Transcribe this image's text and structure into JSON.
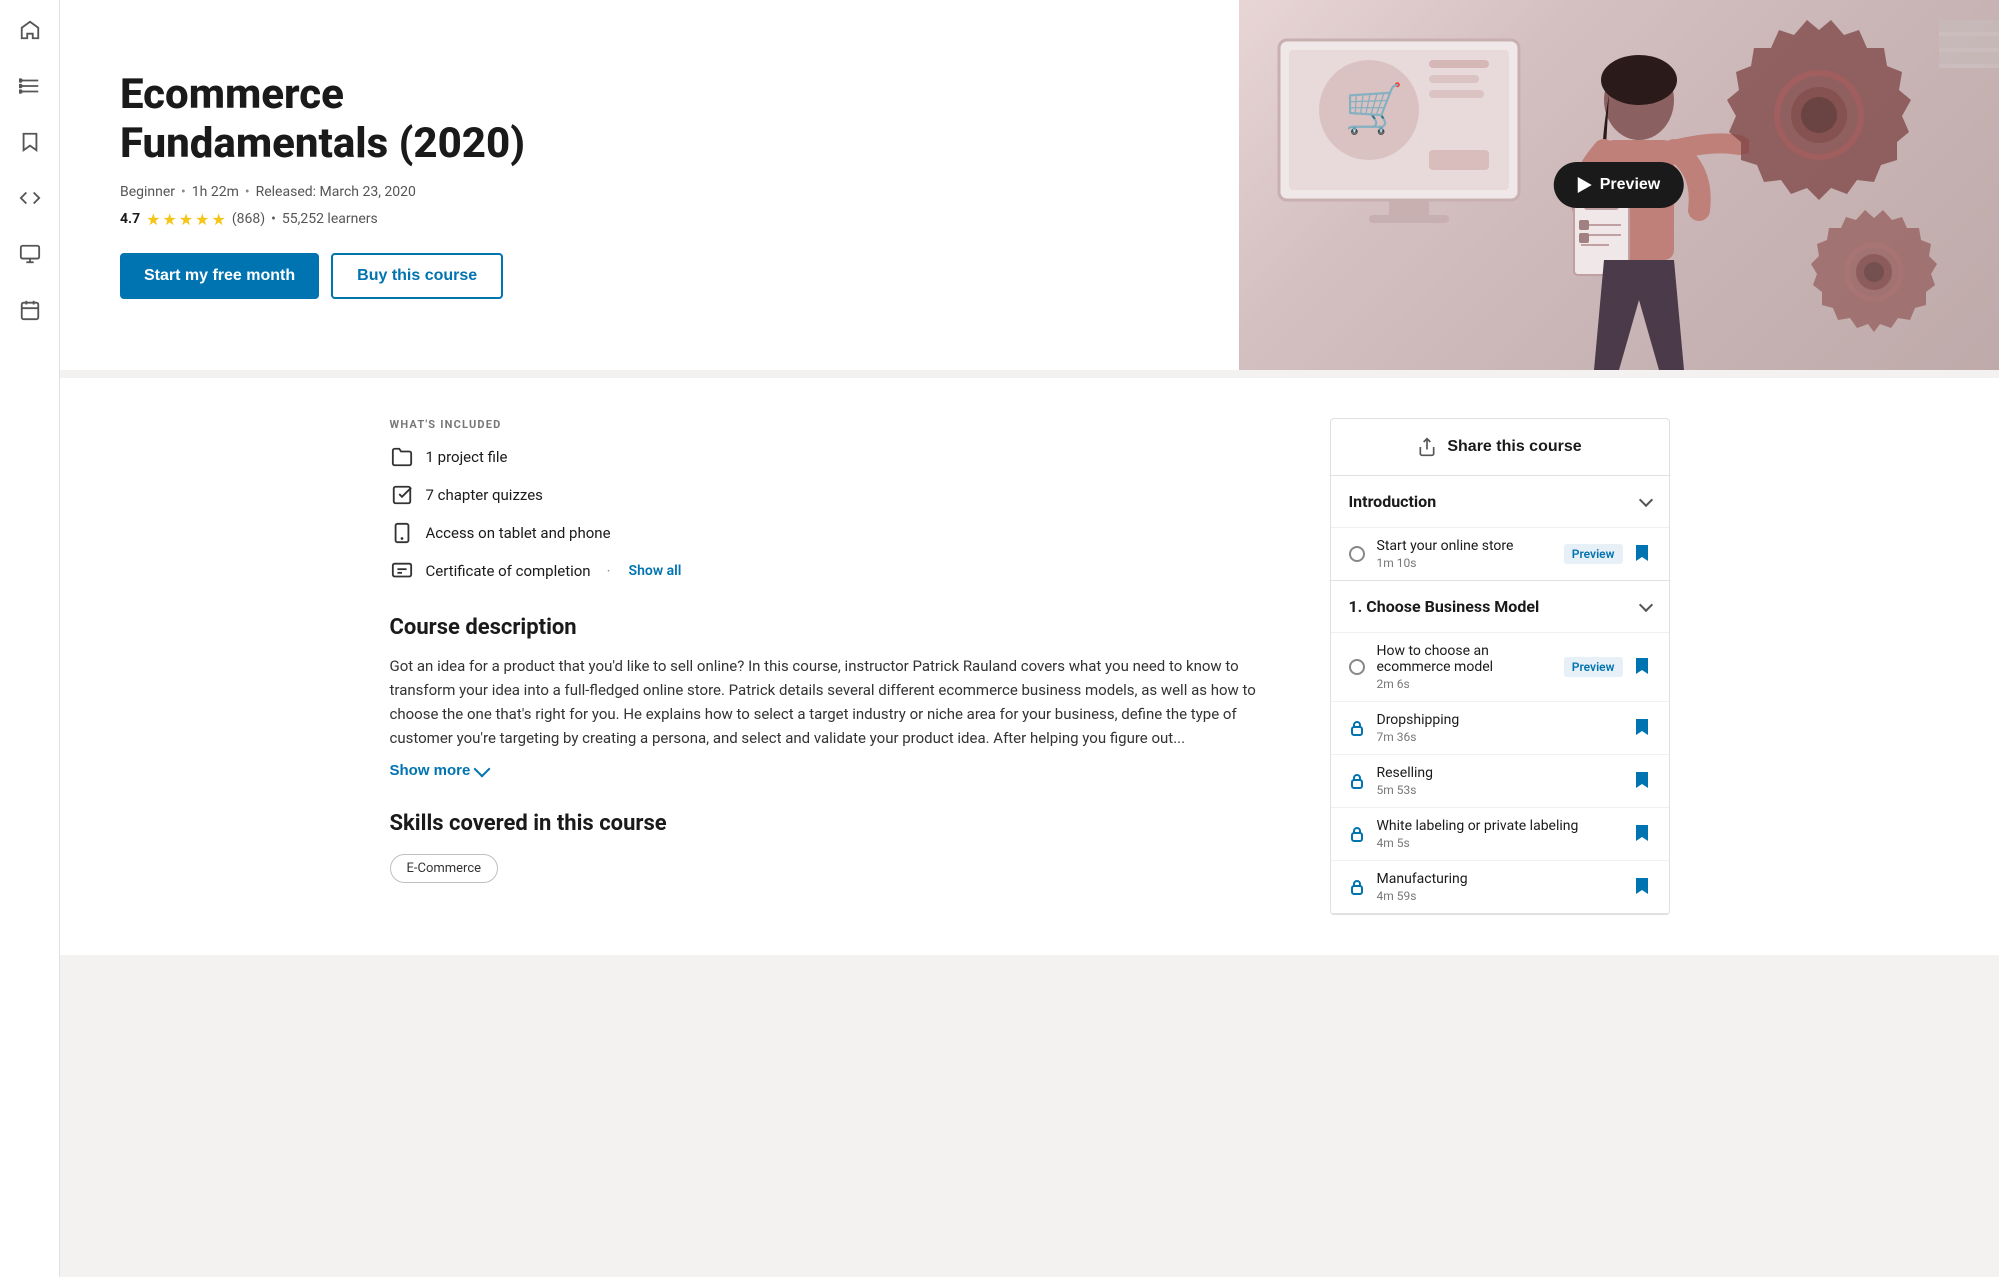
{
  "sidebar": {
    "icons": [
      "home",
      "list",
      "bookmark",
      "code",
      "monitor",
      "calendar"
    ]
  },
  "hero": {
    "title": "Ecommerce Fundamentals (2020)",
    "meta": {
      "level": "Beginner",
      "duration": "1h 22m",
      "released": "Released: March 23, 2020"
    },
    "rating": {
      "score": "4.7",
      "count": "(868)",
      "learners": "55,252 learners"
    },
    "buttons": {
      "primary": "Start my free month",
      "secondary": "Buy this course"
    },
    "preview_label": "Preview"
  },
  "whats_included": {
    "label": "WHAT'S INCLUDED",
    "items": [
      {
        "icon": "folder",
        "text": "1 project file"
      },
      {
        "icon": "quiz",
        "text": "7 chapter quizzes"
      },
      {
        "icon": "phone",
        "text": "Access on tablet and phone"
      },
      {
        "icon": "certificate",
        "text": "Certificate of completion"
      }
    ],
    "show_all": "Show all"
  },
  "course_description": {
    "title": "Course description",
    "text": "Got an idea for a product that you'd like to sell online? In this course, instructor Patrick Rauland covers what you need to know to transform your idea into a full-fledged online store. Patrick details several different ecommerce business models, as well as how to choose the one that's right for you. He explains how to select a target industry or niche area for your business, define the type of customer you're targeting by creating a persona, and select and validate your product idea. After helping you figure out...",
    "show_more": "Show more"
  },
  "skills": {
    "title": "Skills covered in this course",
    "tags": [
      "E-Commerce"
    ]
  },
  "right_sidebar": {
    "share_label": "Share this course",
    "sections": [
      {
        "title": "Introduction",
        "lessons": [
          {
            "title": "Start your online store",
            "duration": "1m 10s",
            "preview": true,
            "locked": false
          }
        ]
      },
      {
        "title": "1. Choose Business Model",
        "lessons": [
          {
            "title": "How to choose an ecommerce model",
            "duration": "2m 6s",
            "preview": true,
            "locked": false
          },
          {
            "title": "Dropshipping",
            "duration": "7m 36s",
            "preview": false,
            "locked": true
          },
          {
            "title": "Reselling",
            "duration": "5m 53s",
            "preview": false,
            "locked": true
          },
          {
            "title": "White labeling or private labeling",
            "duration": "4m 5s",
            "preview": false,
            "locked": true
          },
          {
            "title": "Manufacturing",
            "duration": "4m 59s",
            "preview": false,
            "locked": true
          }
        ]
      }
    ]
  }
}
